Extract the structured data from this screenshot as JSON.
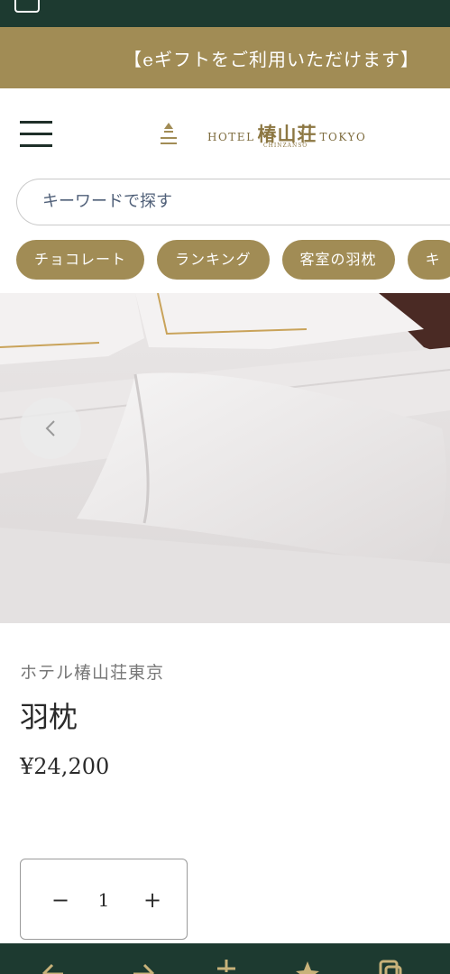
{
  "banner": {
    "text": "【eギフトをご利用いただけます】"
  },
  "header": {
    "logo_prefix": "HOTEL",
    "logo_name": "椿山荘",
    "logo_suffix": "TOKYO",
    "logo_sub": "CHINZANSO"
  },
  "search": {
    "placeholder": "キーワードで探す"
  },
  "chips": [
    "チョコレート",
    "ランキング",
    "客室の羽枕",
    "キ"
  ],
  "product": {
    "brand": "ホテル椿山荘東京",
    "title": "羽枕",
    "price": "¥24,200"
  },
  "quantity": {
    "minus": "−",
    "value": "1",
    "plus": "+"
  },
  "colors": {
    "gold": "#a18c55",
    "dark_green": "#1d3a30"
  },
  "icons": [
    "menu-icon",
    "chevron-left-icon",
    "search-icon"
  ]
}
